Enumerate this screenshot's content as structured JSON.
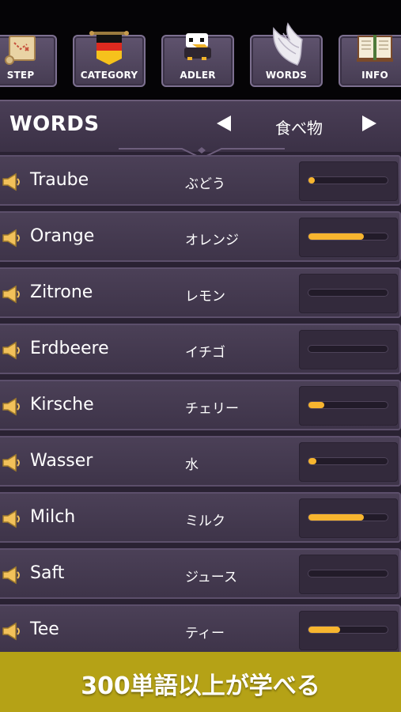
{
  "tabs": [
    {
      "label": "STEP",
      "icon": "map-scroll-icon"
    },
    {
      "label": "CATEGORY",
      "icon": "german-flag-icon"
    },
    {
      "label": "ADLER",
      "icon": "eagle-icon"
    },
    {
      "label": "WORDS",
      "icon": "wing-icon"
    },
    {
      "label": "INFO",
      "icon": "book-icon"
    }
  ],
  "header": {
    "title": "WORDS",
    "category": "食べ物"
  },
  "words": [
    {
      "word": "Traube",
      "translation": "ぶどう",
      "progress": 0.08
    },
    {
      "word": "Orange",
      "translation": "オレンジ",
      "progress": 0.7
    },
    {
      "word": "Zitrone",
      "translation": "レモン",
      "progress": 0.0
    },
    {
      "word": "Erdbeere",
      "translation": "イチゴ",
      "progress": 0.0
    },
    {
      "word": "Kirsche",
      "translation": "チェリー",
      "progress": 0.2
    },
    {
      "word": "Wasser",
      "translation": "水",
      "progress": 0.1
    },
    {
      "word": "Milch",
      "translation": "ミルク",
      "progress": 0.7
    },
    {
      "word": "Saft",
      "translation": "ジュース",
      "progress": 0.0
    },
    {
      "word": "Tee",
      "translation": "ティー",
      "progress": 0.4
    }
  ],
  "banner": {
    "text": "300単語以上が学べる"
  },
  "colors": {
    "accent": "#f7b52f",
    "banner": "#b5a216"
  }
}
